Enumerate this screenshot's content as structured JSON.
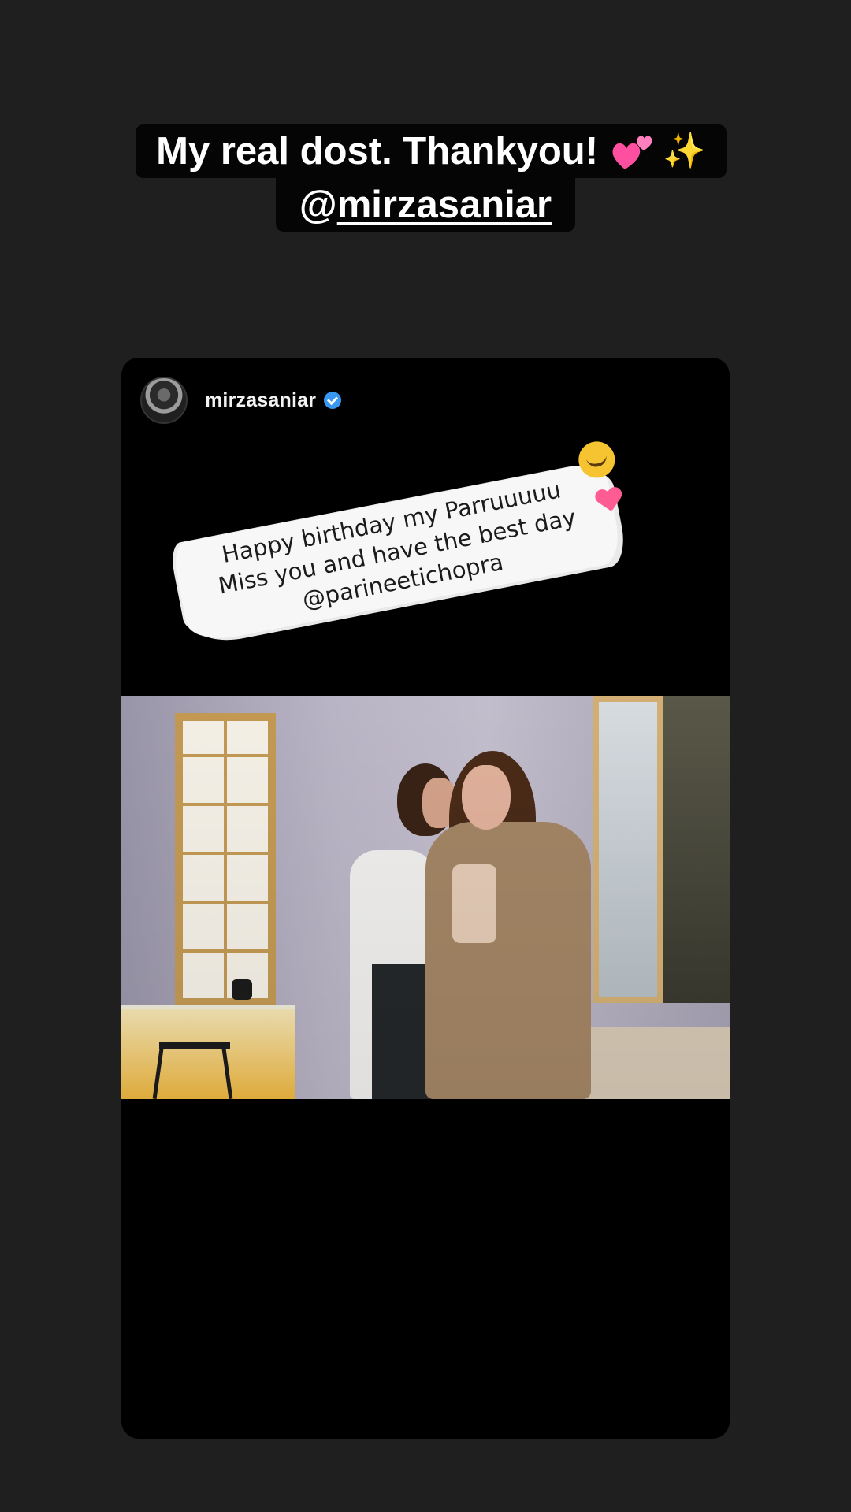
{
  "story": {
    "caption": {
      "line1": "My real dost. Thankyou!",
      "line1_emojis": [
        "two-hearts",
        "sparkles"
      ],
      "mention_prefix": "@",
      "mention": "mirzasaniar"
    },
    "shared_post": {
      "username": "mirzasaniar",
      "verified": true,
      "brush_text": {
        "line1": "Happy birthday my Parruuuuu",
        "line2": "Miss you and have the best day",
        "line3": "@parineetichopra"
      },
      "emojis": [
        "hugging-face",
        "heart"
      ],
      "photo_description_icon": "photo"
    }
  },
  "colors": {
    "background": "#1f1f20",
    "card": "#000000",
    "caption_bg": "#050505",
    "verified": "#3897f0",
    "heart": "#ff5c93"
  }
}
